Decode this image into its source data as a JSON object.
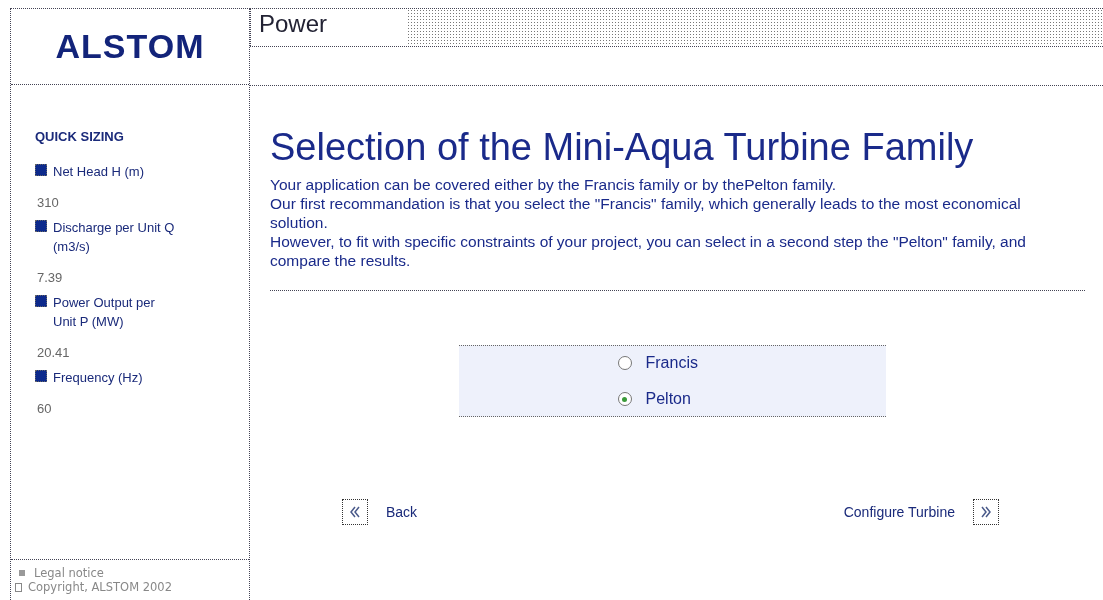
{
  "logo": "ALSTOM",
  "section": "Power",
  "sidebar": {
    "title": "QUICK SIZING",
    "items": [
      {
        "label": "Net Head H (m)",
        "value": "310"
      },
      {
        "label": "Discharge per Unit Q (m3/s)",
        "value": "7.39"
      },
      {
        "label": "Power Output per Unit P (MW)",
        "value": "20.41"
      },
      {
        "label": "Frequency (Hz)",
        "value": "60"
      }
    ]
  },
  "footer": {
    "legal": "Legal notice",
    "copyright": "Copyright, ALSTOM 2002"
  },
  "title": "Selection of the Mini-Aqua Turbine Family",
  "paragraphs": [
    "Your application can be covered either by the Francis family or by thePelton family.",
    "Our first recommandation is that you select the \"Francis\" family, which generally leads to the most economical solution.",
    "However, to fit with specific constraints of your project, you can select in a second step the \"Pelton\" family, and compare the results."
  ],
  "options": [
    {
      "label": "Francis",
      "selected": false
    },
    {
      "label": "Pelton",
      "selected": true
    }
  ],
  "back": "Back",
  "next": "Configure Turbine"
}
